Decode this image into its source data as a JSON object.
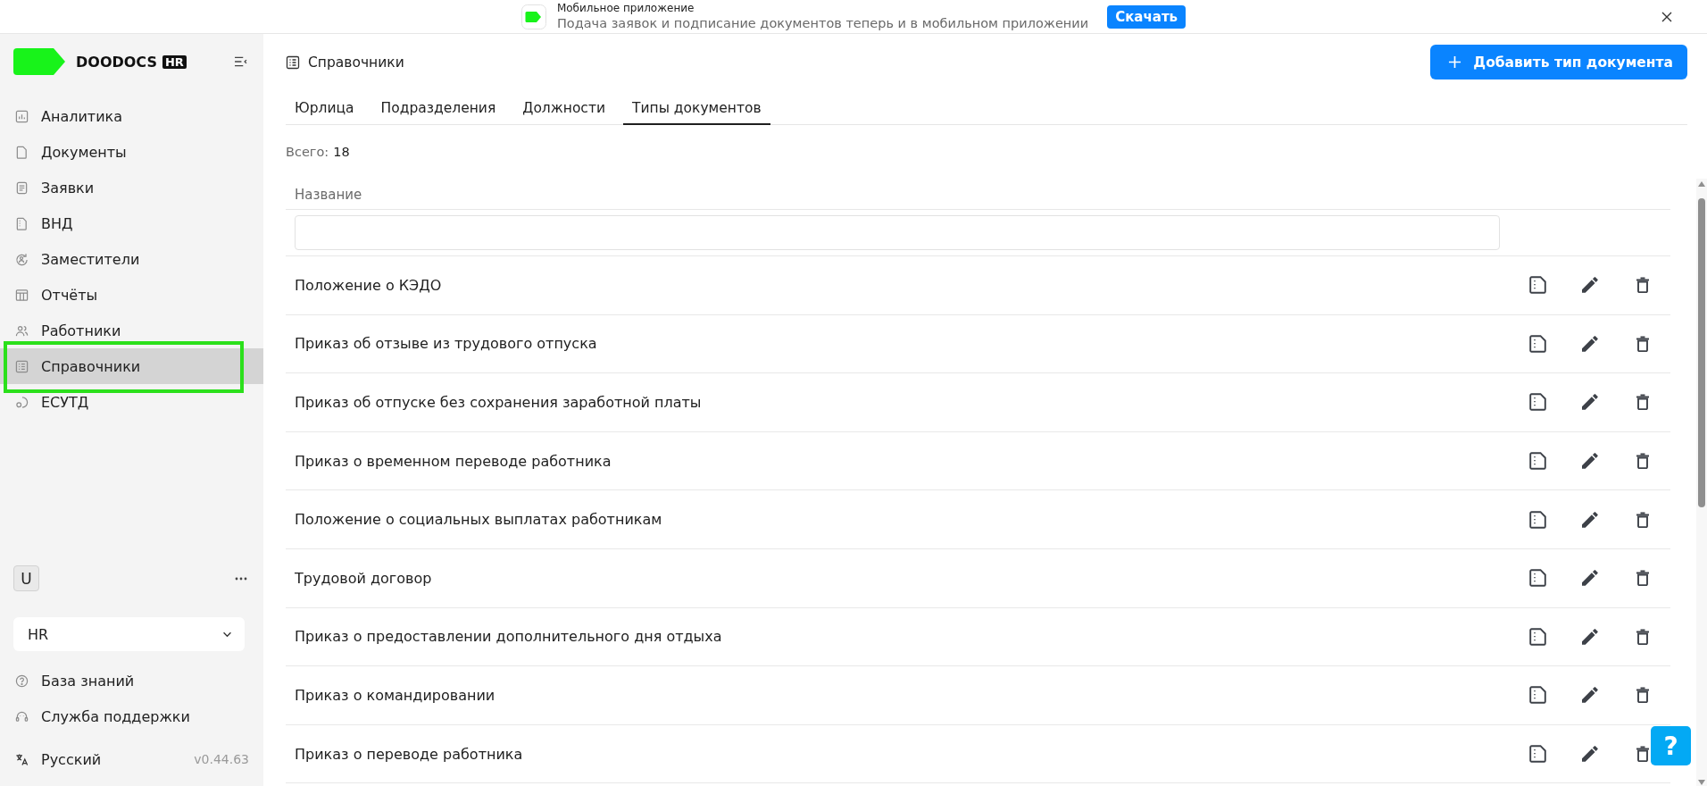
{
  "banner": {
    "title": "Мобильное приложение",
    "text": "Подача заявок и подписание документов теперь и в мобильном приложении",
    "button": "Скачать"
  },
  "sidebar": {
    "brand": "DOODOCS",
    "brand_badge": "HR",
    "items": [
      {
        "label": "Аналитика",
        "selected": false,
        "highlighted": false
      },
      {
        "label": "Документы",
        "selected": false,
        "highlighted": false
      },
      {
        "label": "Заявки",
        "selected": false,
        "highlighted": false
      },
      {
        "label": "ВНД",
        "selected": false,
        "highlighted": false
      },
      {
        "label": "Заместители",
        "selected": false,
        "highlighted": false
      },
      {
        "label": "Отчёты",
        "selected": false,
        "highlighted": false
      },
      {
        "label": "Работники",
        "selected": false,
        "highlighted": false
      },
      {
        "label": "Справочники",
        "selected": true,
        "highlighted": true
      },
      {
        "label": "ЕСУТД",
        "selected": false,
        "highlighted": false
      }
    ],
    "user_initial": "U",
    "workspace": "HR",
    "links": [
      {
        "label": "База знаний"
      },
      {
        "label": "Служба поддержки"
      }
    ],
    "language": "Русский",
    "version": "v0.44.63"
  },
  "page": {
    "title": "Справочники",
    "add_button": "Добавить тип документа",
    "tabs": [
      {
        "label": "Юрлица",
        "selected": false
      },
      {
        "label": "Подразделения",
        "selected": false
      },
      {
        "label": "Должности",
        "selected": false
      },
      {
        "label": "Типы документов",
        "selected": true
      }
    ],
    "total": {
      "label": "Всего:",
      "value": "18"
    },
    "table": {
      "columns": [
        "Название"
      ],
      "rows": [
        {
          "name": "Положение о КЭДО"
        },
        {
          "name": "Приказ об отзыве из трудового отпуска"
        },
        {
          "name": "Приказ об отпуске без сохранения заработной платы"
        },
        {
          "name": "Приказ о временном переводе работника"
        },
        {
          "name": "Положение о социальных выплатах работникам"
        },
        {
          "name": "Трудовой договор"
        },
        {
          "name": "Приказ о предоставлении дополнительного дня отдыха"
        },
        {
          "name": "Приказ о командировании"
        },
        {
          "name": "Приказ о переводе работника"
        }
      ]
    }
  },
  "help_button": "?"
}
